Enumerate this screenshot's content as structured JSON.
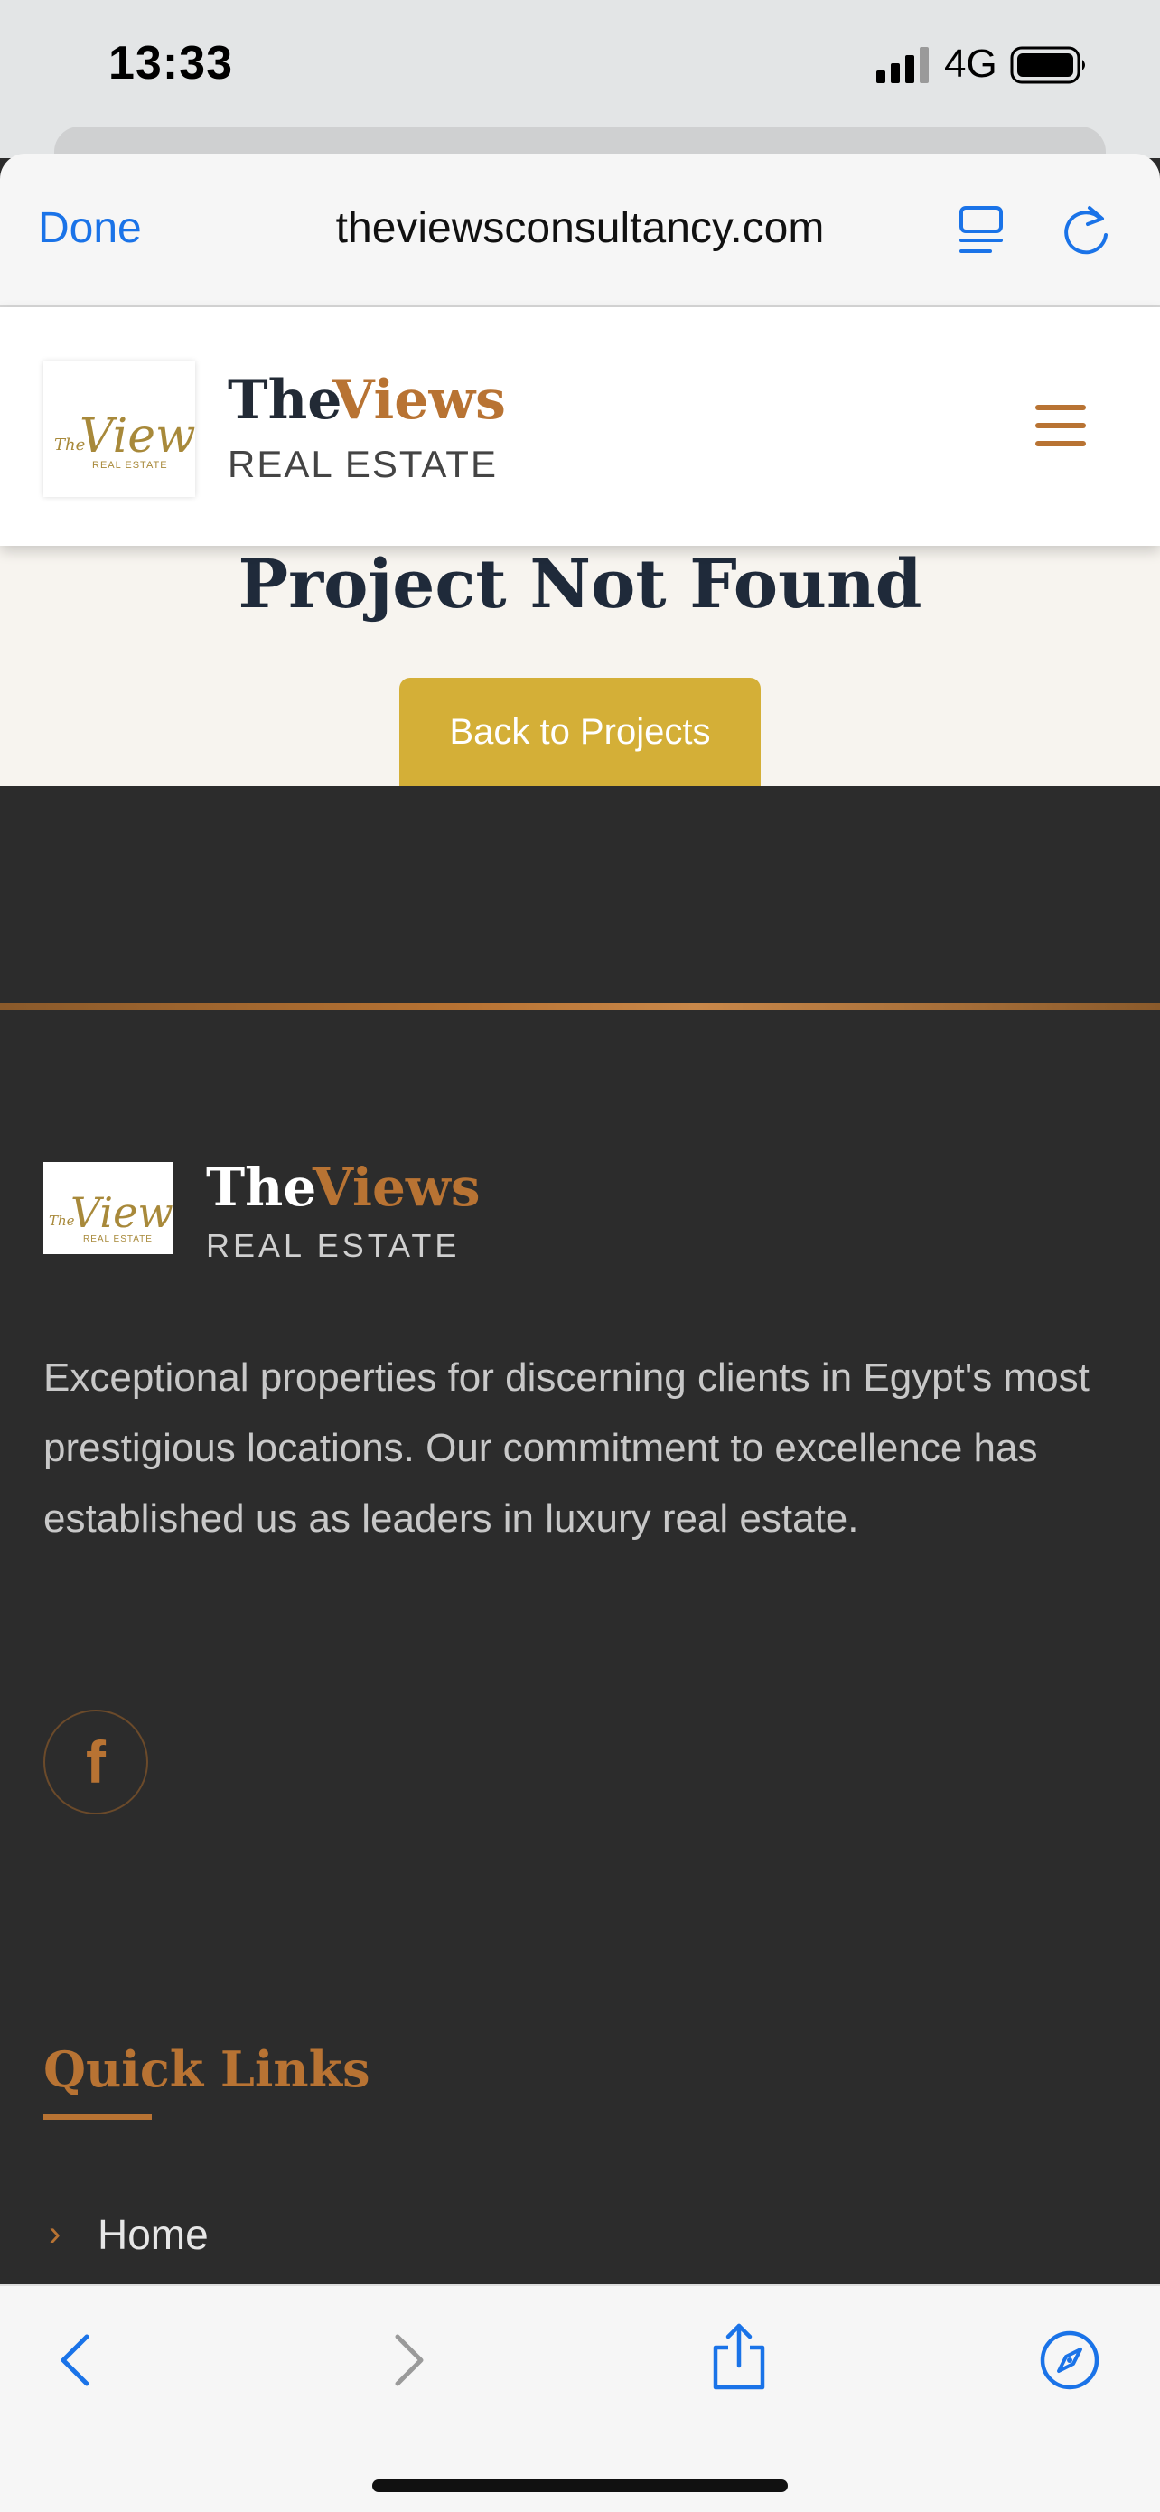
{
  "status_bar": {
    "time": "13:33",
    "network": "4G"
  },
  "browser": {
    "done_label": "Done",
    "url": "theviewsconsultancy.com"
  },
  "site_header": {
    "brand_the": "The",
    "brand_views": "Views",
    "brand_sub": "REAL ESTATE",
    "logo_text": "Views",
    "logo_prefix": "The",
    "logo_sub": "REAL ESTATE"
  },
  "not_found": {
    "title": "Project Not Found",
    "back_label": "Back to Projects"
  },
  "footer": {
    "brand_the": "The",
    "brand_views": "Views",
    "brand_sub": "REAL ESTATE",
    "description": "Exceptional properties for discerning clients in Egypt's most prestigious locations. Our commitment to excellence has established us as leaders in luxury real estate.",
    "facebook_glyph": "f",
    "quick_links_heading": "Quick Links",
    "quick_links": [
      {
        "label": "Home"
      }
    ]
  },
  "colors": {
    "accent_copper": "#b87333",
    "button_gold": "#d4af37",
    "footer_bg": "#2c2c2c",
    "ios_blue": "#1a73e8"
  },
  "icons": {
    "signal": "cellular-signal-icon",
    "battery": "battery-icon",
    "reader": "reader-mode-icon",
    "reload": "reload-icon",
    "menu": "hamburger-menu-icon",
    "facebook": "facebook-icon",
    "chevron": "chevron-right-icon",
    "back": "chevron-left-icon",
    "forward": "chevron-right-icon",
    "share": "share-icon",
    "safari": "compass-icon"
  }
}
